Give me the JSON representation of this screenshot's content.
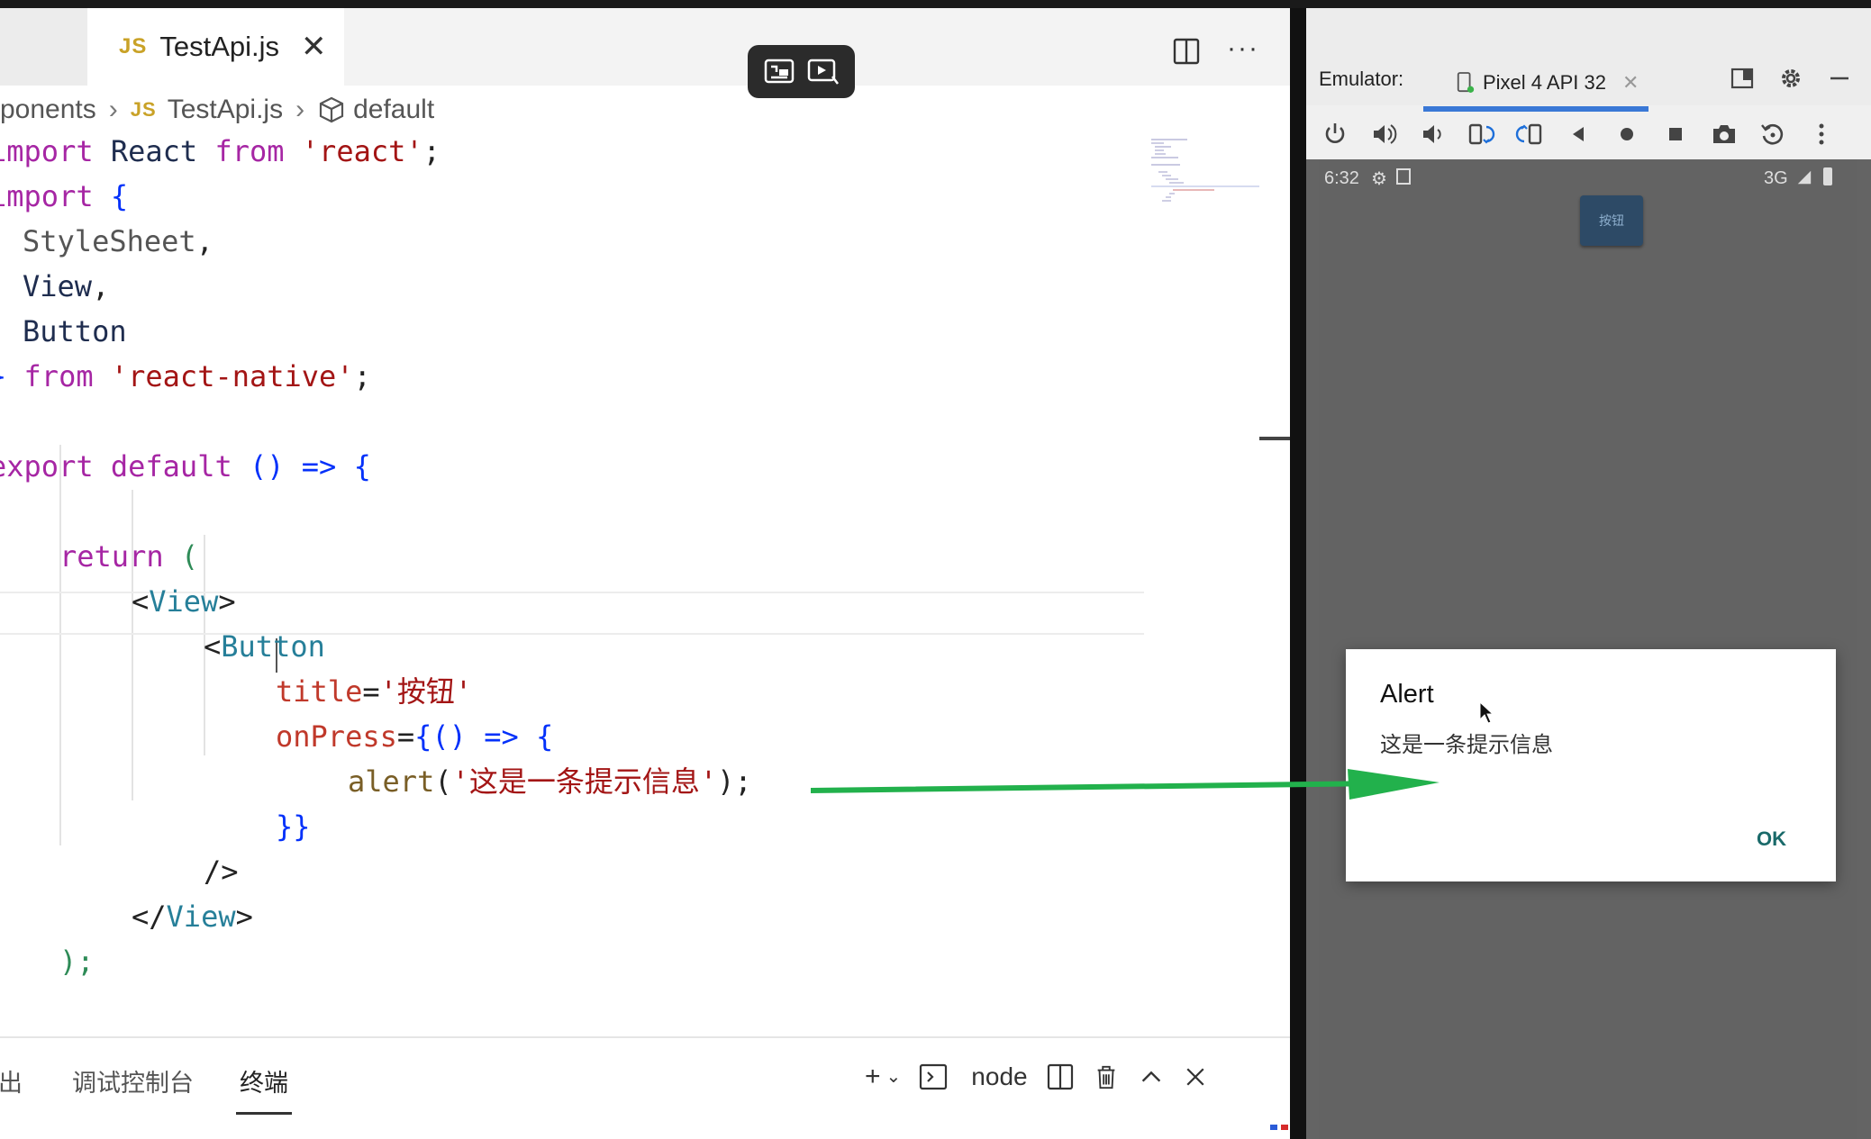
{
  "editor": {
    "tab": {
      "icon": "js-icon",
      "icon_text": "JS",
      "title": "TestApi.js",
      "close": "✕"
    },
    "breadcrumb": {
      "part1": "ponents",
      "part2_icon": "JS",
      "part2": "TestApi.js",
      "part3": "default"
    },
    "code": {
      "l1_kw": "import",
      "l1_id": "React",
      "l1_from": "from",
      "l1_str": "'react'",
      "l1_end": ";",
      "l2_kw": "import",
      "l2_brace": "{",
      "l3_id": "StyleSheet",
      "l3_end": ",",
      "l4_id": "View",
      "l4_end": ",",
      "l5_id": "Button",
      "l6_brace": "}",
      "l6_from": "from",
      "l6_str": "'react-native'",
      "l6_end": ";",
      "l8_kw": "export",
      "l8_kw2": "default",
      "l8_parens": "()",
      "l8_arrow": "=>",
      "l8_brace": "{",
      "l10_kw": "return",
      "l10_paren": "(",
      "l11_open": "<",
      "l11_tag": "View",
      "l11_close": ">",
      "l12_open": "<",
      "l12_tag": "Button",
      "l13_attr": "title",
      "l13_eq": "=",
      "l13_str": "'按钮'",
      "l14_attr": "onPress",
      "l14_eq": "=",
      "l14_braces": "{() => {",
      "l15_fn": "alert",
      "l15_paren1": "(",
      "l15_str": "'这是一条提示信息'",
      "l15_paren2": ");",
      "l16_braces": "}}",
      "l17_selfclose": "/>",
      "l18_open": "</",
      "l18_tag": "View",
      "l18_close": ">",
      "l19_end": ");"
    }
  },
  "panel": {
    "tab_output": "出",
    "tab_debug": "调试控制台",
    "tab_terminal": "终端",
    "terminal_name": "node"
  },
  "emulator": {
    "label": "Emulator:",
    "device": "Pixel 4 API 32",
    "status_time": "6:32",
    "status_net": "3G",
    "app_button": "按钮",
    "dialog": {
      "title": "Alert",
      "message": "这是一条提示信息",
      "ok": "OK"
    }
  },
  "colors": {
    "accent": "#3a78d6",
    "arrow": "#22b14c",
    "keyword": "#a626a4",
    "string": "#a31515"
  }
}
